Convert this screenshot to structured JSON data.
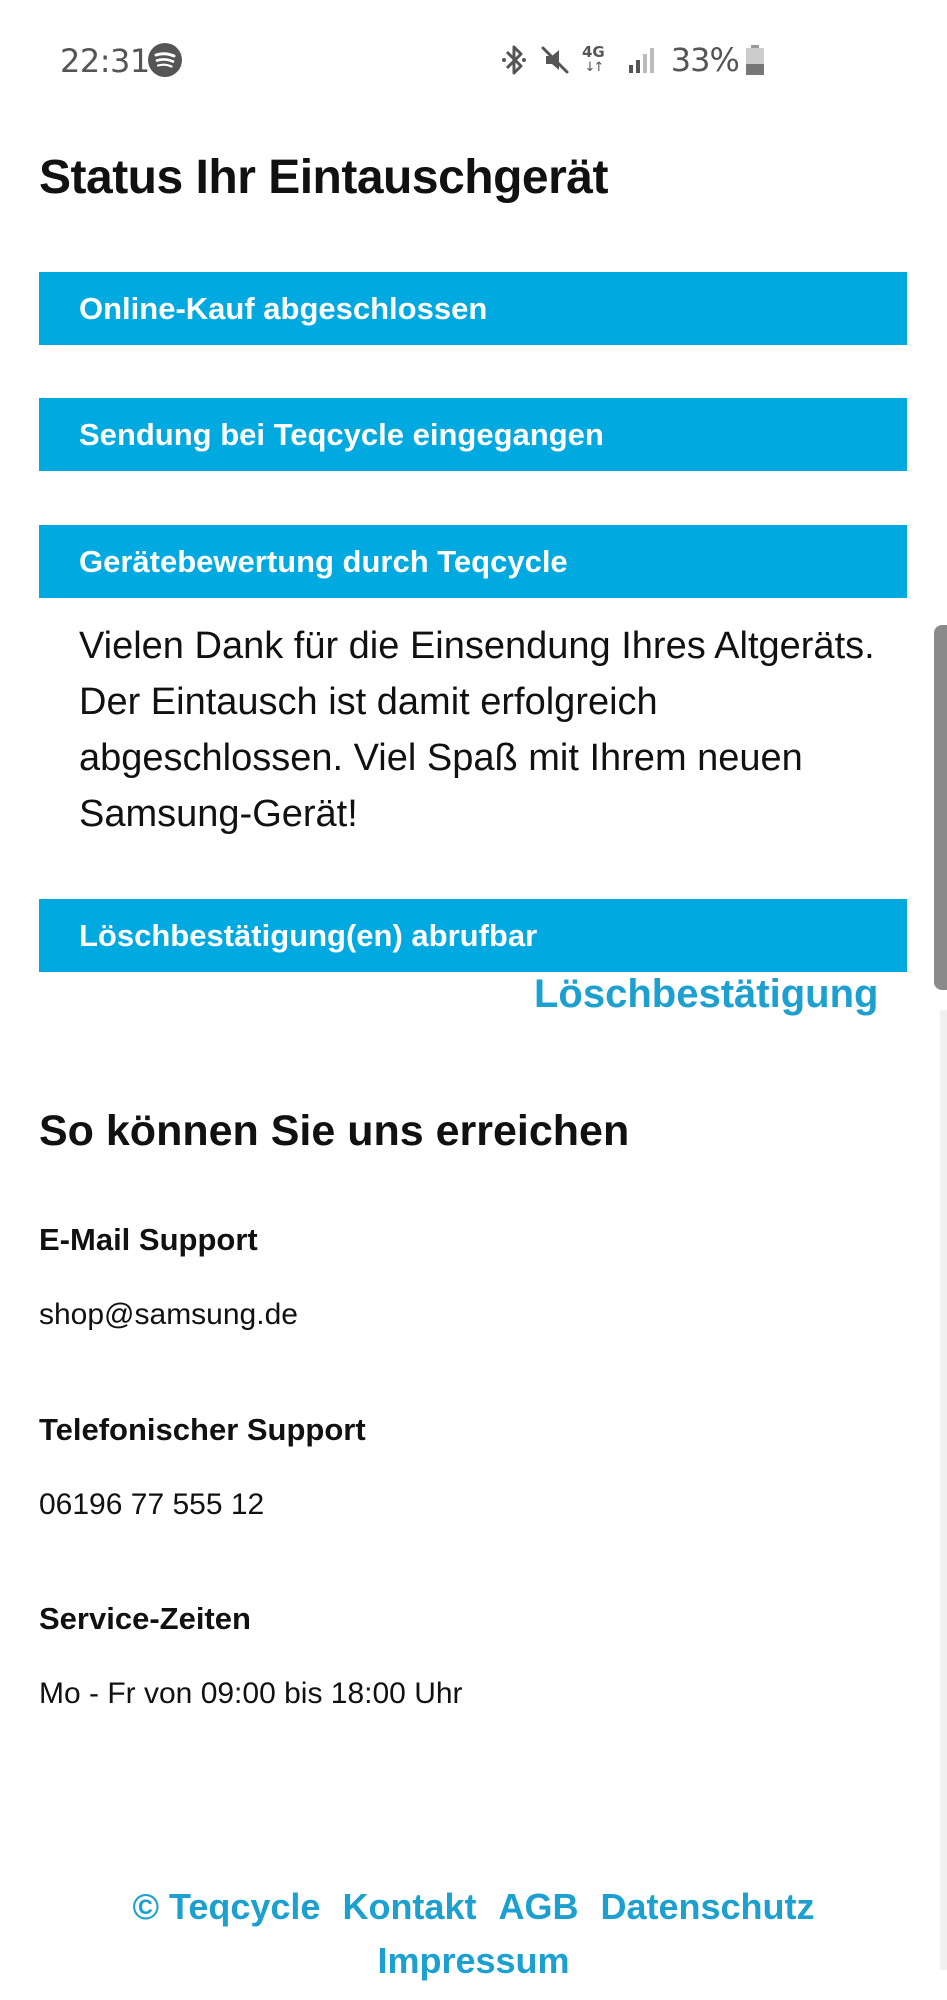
{
  "status_bar": {
    "time": "22:31",
    "network": "4G",
    "battery_percent": "33%",
    "icons": [
      "spotify-icon",
      "bluetooth-icon",
      "mute-icon",
      "network-4g-icon",
      "signal-icon",
      "battery-icon"
    ]
  },
  "page_title": "Status Ihr Eintauschgerät",
  "steps": [
    {
      "label": "Online-Kauf abgeschlossen"
    },
    {
      "label": "Sendung bei Teqcycle eingegangen"
    },
    {
      "label": "Gerätebewertung durch Teqcycle"
    },
    {
      "label": "Löschbestätigung(en) abrufbar"
    }
  ],
  "evaluation_message": "Vielen Dank für die Einsendung Ihres Altgeräts. Der Eintausch ist damit erfolgreich abgeschlossen. Viel Spaß mit Ihrem neuen Samsung-Gerät!",
  "deletion_link": "Löschbestätigung",
  "contact": {
    "title": "So können Sie uns erreichen",
    "email_heading": "E-Mail Support",
    "email": "shop@samsung.de",
    "phone_heading": "Telefonischer Support",
    "phone": "06196 77 555 12",
    "hours_heading": "Service-Zeiten",
    "hours": "Mo - Fr von 09:00 bis 18:00 Uhr"
  },
  "footer": {
    "copyright": "© Teqcycle",
    "contact": "Kontakt",
    "terms": "AGB",
    "privacy": "Datenschutz",
    "imprint": "Impressum"
  },
  "colors": {
    "accent": "#00a9e0",
    "link": "#1ba0cf"
  }
}
